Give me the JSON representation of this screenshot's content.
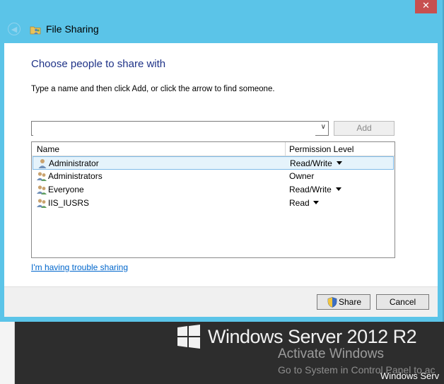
{
  "window": {
    "title": "File Sharing",
    "close_symbol": "✕",
    "back_symbol": "◀"
  },
  "dialog": {
    "heading": "Choose people to share with",
    "instructions": "Type a name and then click Add, or click the arrow to find someone.",
    "name_input": {
      "value": ""
    },
    "add_label": "Add",
    "columns": {
      "name": "Name",
      "permission": "Permission Level"
    },
    "rows": [
      {
        "name": "Administrator",
        "permission": "Read/Write",
        "has_dropdown": true,
        "icon": "user-icon",
        "selected": true
      },
      {
        "name": "Administrators",
        "permission": "Owner",
        "has_dropdown": false,
        "icon": "group-icon",
        "selected": false
      },
      {
        "name": "Everyone",
        "permission": "Read/Write",
        "has_dropdown": true,
        "icon": "group-icon",
        "selected": false
      },
      {
        "name": "IIS_IUSRS",
        "permission": "Read",
        "has_dropdown": true,
        "icon": "group-icon",
        "selected": false
      }
    ],
    "trouble_link": "I'm having trouble sharing",
    "share_label": "Share",
    "cancel_label": "Cancel"
  },
  "desktop": {
    "brand": "Windows Server 2012 R2",
    "activate_title": "Activate Windows",
    "activate_detail": "Go to System in Control Panel to ac",
    "corner_text": "Windows Serv"
  },
  "colors": {
    "title_bar": "#5bc4e8",
    "heading": "#1e3287",
    "link": "#0066cc",
    "close": "#c75050",
    "selection": "#e5f3fb"
  }
}
